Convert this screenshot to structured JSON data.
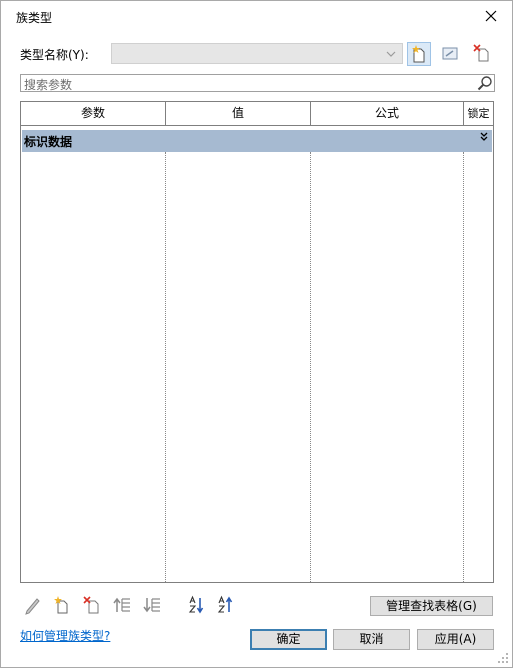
{
  "window": {
    "title": "族类型",
    "close_icon": "close-icon"
  },
  "type_name": {
    "label": "类型名称(Y):",
    "value": ""
  },
  "toolbar": {
    "new_icon": "new-type-icon",
    "rename_icon": "rename-type-icon",
    "delete_icon": "delete-type-icon"
  },
  "search": {
    "placeholder": "搜索参数",
    "icon": "search-icon"
  },
  "table": {
    "columns": [
      "参数",
      "值",
      "公式",
      "锁定"
    ],
    "groups": [
      {
        "label": "标识数据",
        "toggle": "collapse-chevron-icon"
      }
    ]
  },
  "bottom_toolbar": {
    "icons": [
      "edit-parameter-icon",
      "new-parameter-icon",
      "delete-parameter-icon",
      "move-up-icon",
      "move-down-icon",
      "sort-ascending-icon",
      "sort-descending-icon"
    ],
    "manage_lookup_label": "管理查找表格(G)"
  },
  "help": {
    "link_text": "如何管理族类型?"
  },
  "buttons": {
    "ok": "确定",
    "cancel": "取消",
    "apply": "应用(A)"
  },
  "colors": {
    "group_header": "#a6bad1",
    "link": "#0066cc",
    "default_button_border": "#3c7fb1"
  }
}
